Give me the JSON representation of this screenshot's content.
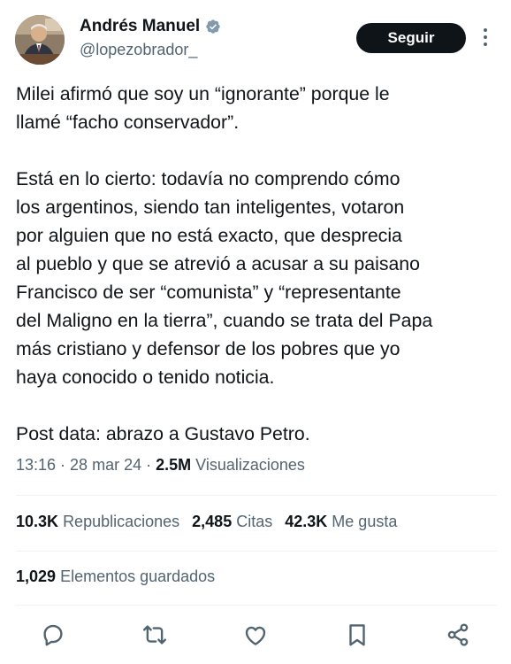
{
  "author": {
    "name": "Andrés Manuel",
    "handle": "@lopezobrador_"
  },
  "follow_label": "Seguir",
  "tweet_text": "Milei afirmó que soy un “ignorante” porque le\nllamé “facho conservador”.\n\nEstá en lo cierto: todavía no comprendo cómo\nlos argentinos, siendo tan inteligentes, votaron\npor alguien que no está exacto, que desprecia\nal pueblo y que se atrevió a acusar a su paisano\nFrancisco de ser “comunista” y “representante\ndel Maligno en la tierra”, cuando se trata del Papa\nmás cristiano y defensor de los pobres que yo\nhaya conocido o tenido noticia.\n\nPost data: abrazo a Gustavo Petro.",
  "meta": {
    "time": "13:16",
    "sep1": " · ",
    "date": "28 mar 24",
    "sep2": " · ",
    "views_count": "2.5M",
    "views_label": "Visualizaciones"
  },
  "stats": [
    {
      "count": "10.3K",
      "label": "Republicaciones"
    },
    {
      "count": "2,485",
      "label": "Citas"
    },
    {
      "count": "42.3K",
      "label": "Me gusta"
    }
  ],
  "saved": {
    "count": "1,029",
    "label": "Elementos guardados"
  },
  "actions": [
    "reply-icon",
    "retweet-icon",
    "like-icon",
    "bookmark-icon",
    "share-icon"
  ],
  "colors": {
    "text": "#0f1419",
    "secondary": "#536471",
    "verified": "#829aab",
    "button_bg": "#0f1419",
    "divider": "#eff3f4"
  }
}
